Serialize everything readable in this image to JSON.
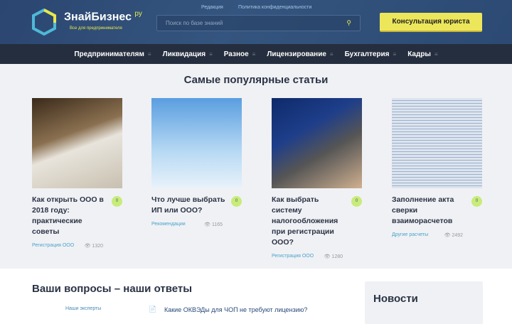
{
  "header": {
    "logo_name": "ЗнайБизнес",
    "logo_suffix": "ру",
    "tagline": "Все для предпринимателя",
    "links": [
      "Редакция",
      "Политика конфиденциальности"
    ],
    "search_placeholder": "Поиск по базе знаний",
    "cta": "Консультация юриста"
  },
  "nav": [
    "Предпринимателям",
    "Ликвидация",
    "Разное",
    "Лицензирование",
    "Бухгалтерия",
    "Кадры"
  ],
  "popular": {
    "title": "Самые популярные статьи",
    "cards": [
      {
        "title": "Как открыть ООО в 2018 году: практические советы",
        "comments": "0",
        "category": "Регистрация ООО",
        "views": "1320"
      },
      {
        "title": "Что лучше выбрать ИП или ООО?",
        "comments": "0",
        "category": "Рекомендации",
        "views": "1165"
      },
      {
        "title": "Как выбрать систему налогообложения при регистрации ООО?",
        "comments": "0",
        "category": "Регистрация ООО",
        "views": "1280"
      },
      {
        "title": "Заполнение акта сверки взаиморасчетов",
        "comments": "0",
        "category": "Другие расчеты",
        "views": "2492"
      }
    ]
  },
  "qa": {
    "title": "Ваши вопросы – наши ответы",
    "experts": "Наши эксперты",
    "question": "Какие ОКВЭДы для ЧОП не требуют лицензию?"
  },
  "news": {
    "title": "Новости"
  }
}
